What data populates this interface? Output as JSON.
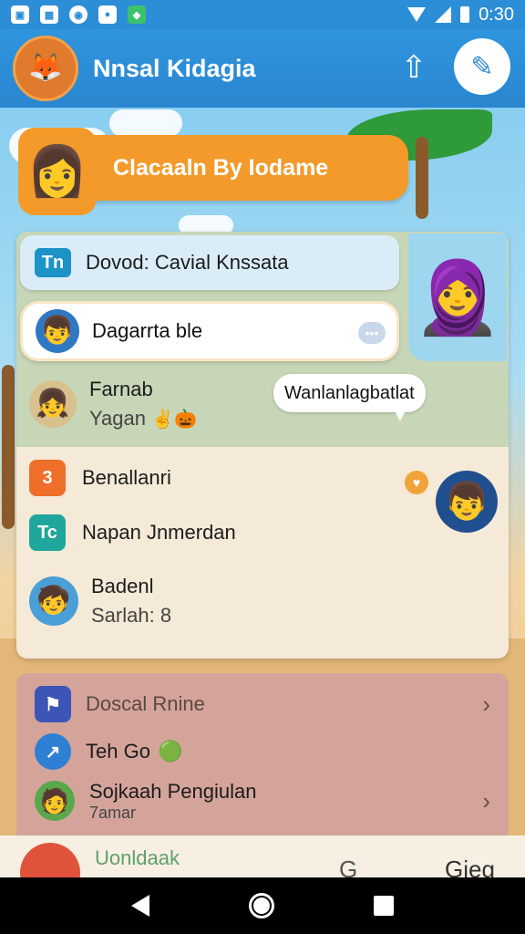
{
  "status_bar": {
    "time": "0:30",
    "icons": [
      "image-icon",
      "gallery-icon",
      "sync-icon",
      "app-icon",
      "game-icon"
    ]
  },
  "header": {
    "title": "Nnsal Kidagia"
  },
  "banner": {
    "text": "Clacaaln By Iodame"
  },
  "search": {
    "badge": "Tn",
    "text": "Dovod: Cavial Knssata"
  },
  "pinned": {
    "label": "Dagarrta ble"
  },
  "chat_list": [
    {
      "title": "Farnab",
      "subtitle": "Yagan"
    },
    {
      "title": "Benallanri",
      "icon": "3"
    },
    {
      "title": "Napan Jnmerdan",
      "icon": "Tc"
    },
    {
      "title": "Badenl",
      "subtitle": "Sarlah: 8"
    }
  ],
  "bubble": {
    "text": "Wanlanlagbatlat"
  },
  "menu": [
    {
      "label": "Doscal Rnine"
    },
    {
      "label": "Teh Go"
    },
    {
      "label": "Sojkaah Pengiulan",
      "subtitle": "7amar"
    }
  ],
  "bottom": {
    "label": "Uonldaak",
    "right_a": "G",
    "right_b": "Gieg"
  },
  "colors": {
    "header": "#2a86cf",
    "banner": "#f39a2a",
    "card": "#f5ead7",
    "card2": "#d4a49b"
  }
}
